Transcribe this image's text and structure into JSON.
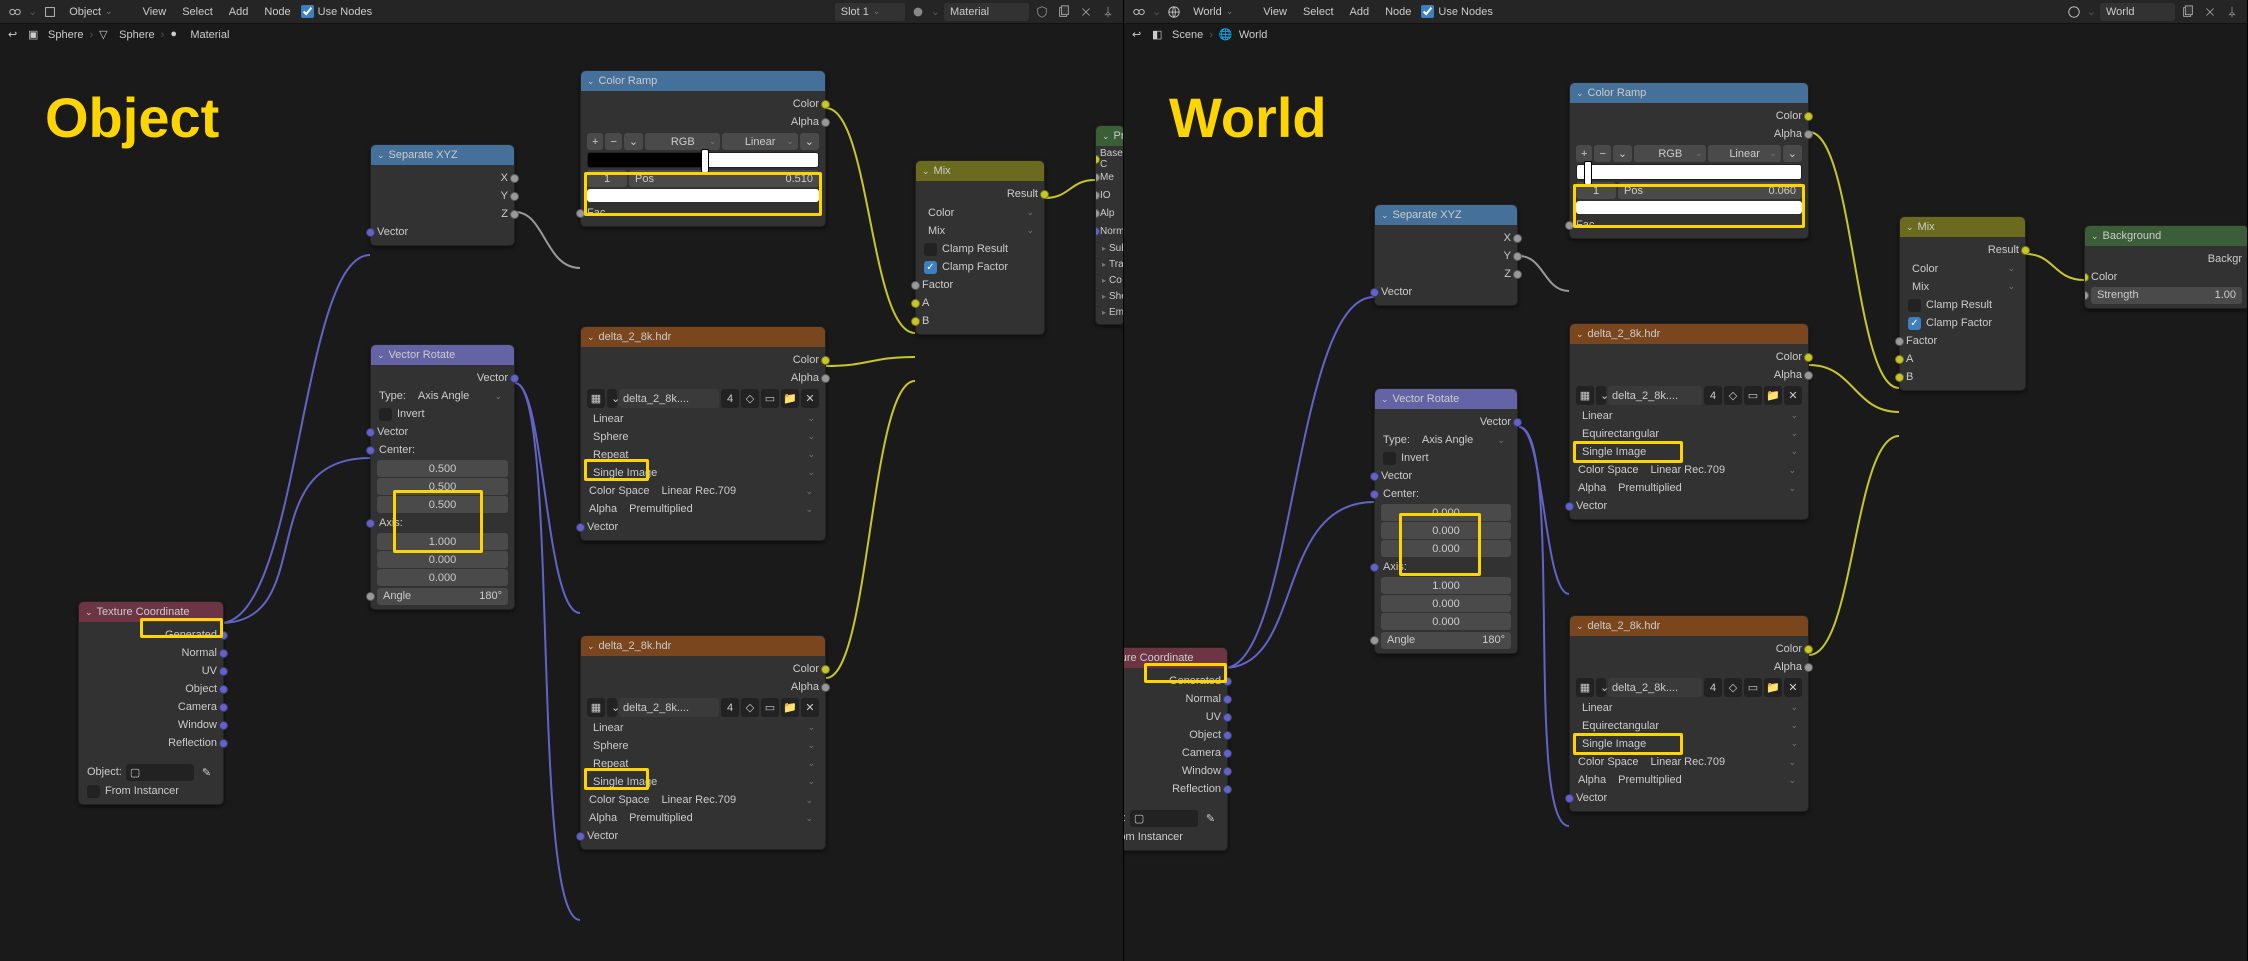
{
  "left": {
    "title": "Object",
    "topbar": {
      "object": "Object",
      "menus": [
        "View",
        "Select",
        "Add",
        "Node"
      ],
      "useNodes": "Use Nodes",
      "slot": "Slot 1",
      "material": "Material"
    },
    "breadcrumb": {
      "item1": "Sphere",
      "item2": "Sphere",
      "item3": "Material"
    },
    "nodes": {
      "textureCoord": {
        "title": "Texture Coordinate",
        "outputs": [
          "Generated",
          "Normal",
          "UV",
          "Object",
          "Camera",
          "Window",
          "Reflection"
        ],
        "objectLabel": "Object:",
        "fromInstancer": "From Instancer"
      },
      "separateXYZ": {
        "title": "Separate XYZ",
        "x": "X",
        "y": "Y",
        "z": "Z",
        "vector": "Vector"
      },
      "vectorRotate": {
        "title": "Vector Rotate",
        "outVector": "Vector",
        "typeLabel": "Type:",
        "typeValue": "Axis Angle",
        "invert": "Invert",
        "vector": "Vector",
        "centerLabel": "Center:",
        "center": [
          "0.500",
          "0.500",
          "0.500"
        ],
        "axisLabel": "Axis:",
        "axis": [
          "1.000",
          "0.000",
          "0.000"
        ],
        "angleLabel": "Angle",
        "angleValue": "180°"
      },
      "colorRamp": {
        "title": "Color Ramp",
        "color": "Color",
        "alpha": "Alpha",
        "rgb": "RGB",
        "interp": "Linear",
        "indexVal": "1",
        "posLabel": "Pos",
        "posVal": "0.510",
        "fac": "Fac"
      },
      "envTex1": {
        "title": "delta_2_8k.hdr",
        "color": "Color",
        "alpha": "Alpha",
        "imgName": "delta_2_8k....",
        "users": "4",
        "interp": "Linear",
        "proj": "Sphere",
        "repeat": "Repeat",
        "single": "Single Image",
        "colorSpaceLabel": "Color Space",
        "colorSpaceVal": "Linear Rec.709",
        "alphaLabel": "Alpha",
        "alphaVal": "Premultiplied",
        "vector": "Vector"
      },
      "envTex2": {
        "title": "delta_2_8k.hdr",
        "color": "Color",
        "alpha": "Alpha",
        "imgName": "delta_2_8k....",
        "users": "4",
        "interp": "Linear",
        "proj": "Sphere",
        "repeat": "Repeat",
        "single": "Single Image",
        "colorSpaceLabel": "Color Space",
        "colorSpaceVal": "Linear Rec.709",
        "alphaLabel": "Alpha",
        "alphaVal": "Premultiplied",
        "vector": "Vector"
      },
      "mix": {
        "title": "Mix",
        "result": "Result",
        "dataType": "Color",
        "blend": "Mix",
        "clampResult": "Clamp Result",
        "clampFactor": "Clamp Factor",
        "factor": "Factor",
        "a": "A",
        "b": "B"
      },
      "bsdf": {
        "title": "Prin",
        "base": "Base C",
        "me": "Me",
        "io": "IO",
        "alp": "Alp",
        "normal": "Norma",
        "subsurface": "Sub",
        "tra": "Tra",
        "co": "Co",
        "she": "She",
        "em": "Em"
      }
    }
  },
  "right": {
    "title": "World",
    "topbar": {
      "world": "World",
      "menus": [
        "View",
        "Select",
        "Add",
        "Node"
      ],
      "useNodes": "Use Nodes",
      "worldSlot": "World"
    },
    "breadcrumb": {
      "item1": "Scene",
      "item2": "World"
    },
    "nodes": {
      "textureCoord": {
        "title": "Texture Coordinate",
        "outputs": [
          "Generated",
          "Normal",
          "UV",
          "Object",
          "Camera",
          "Window",
          "Reflection"
        ],
        "objectLabel": "Object:",
        "fromInstancer": "From Instancer"
      },
      "separateXYZ": {
        "title": "Separate XYZ",
        "x": "X",
        "y": "Y",
        "z": "Z",
        "vector": "Vector"
      },
      "vectorRotate": {
        "title": "Vector Rotate",
        "outVector": "Vector",
        "typeLabel": "Type:",
        "typeValue": "Axis Angle",
        "invert": "Invert",
        "vector": "Vector",
        "centerLabel": "Center:",
        "center": [
          "0.000",
          "0.000",
          "0.000"
        ],
        "axisLabel": "Axis:",
        "axis": [
          "1.000",
          "0.000",
          "0.000"
        ],
        "angleLabel": "Angle",
        "angleValue": "180°"
      },
      "colorRamp": {
        "title": "Color Ramp",
        "color": "Color",
        "alpha": "Alpha",
        "rgb": "RGB",
        "interp": "Linear",
        "indexVal": "1",
        "posLabel": "Pos",
        "posVal": "0.060",
        "fac": "Fac"
      },
      "envTex1": {
        "title": "delta_2_8k.hdr",
        "color": "Color",
        "alpha": "Alpha",
        "imgName": "delta_2_8k....",
        "users": "4",
        "interp": "Linear",
        "proj": "Equirectangular",
        "single": "Single Image",
        "colorSpaceLabel": "Color Space",
        "colorSpaceVal": "Linear Rec.709",
        "alphaLabel": "Alpha",
        "alphaVal": "Premultiplied",
        "vector": "Vector"
      },
      "envTex2": {
        "title": "delta_2_8k.hdr",
        "color": "Color",
        "alpha": "Alpha",
        "imgName": "delta_2_8k....",
        "users": "4",
        "interp": "Linear",
        "proj": "Equirectangular",
        "single": "Single Image",
        "colorSpaceLabel": "Color Space",
        "colorSpaceVal": "Linear Rec.709",
        "alphaLabel": "Alpha",
        "alphaVal": "Premultiplied",
        "vector": "Vector"
      },
      "mix": {
        "title": "Mix",
        "result": "Result",
        "dataType": "Color",
        "blend": "Mix",
        "clampResult": "Clamp Result",
        "clampFactor": "Clamp Factor",
        "factor": "Factor",
        "a": "A",
        "b": "B"
      },
      "background": {
        "title": "Background",
        "out": "Backgr",
        "color": "Color",
        "strengthLabel": "Strength",
        "strengthVal": "1.00"
      }
    }
  }
}
